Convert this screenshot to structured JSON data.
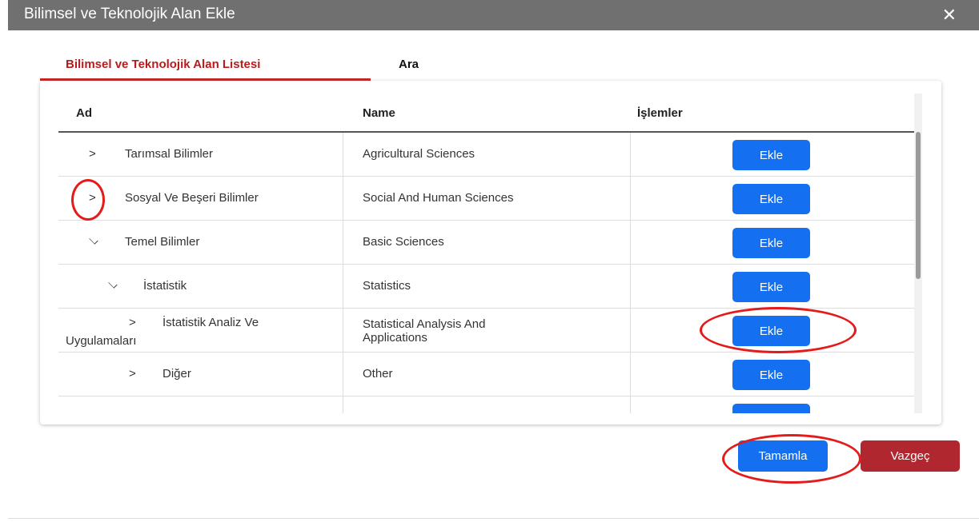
{
  "dialog": {
    "title": "Bilimsel ve Teknolojik Alan Ekle",
    "close_label": "✕"
  },
  "tabs": [
    {
      "label": "Bilimsel ve Teknolojik Alan Listesi",
      "active": true
    },
    {
      "label": "Ara",
      "active": false
    }
  ],
  "table": {
    "headers": {
      "ad": "Ad",
      "name": "Name",
      "islemler": "İşlemler"
    },
    "rows": [
      {
        "ad": "Tarımsal Bilimler",
        "name": "Agricultural Sciences",
        "expander": "collapsed",
        "action": "Ekle"
      },
      {
        "ad": "Sosyal Ve Beşeri Bilimler",
        "name": "Social And Human Sciences",
        "expander": "collapsed",
        "action": "Ekle"
      },
      {
        "ad": "Temel Bilimler",
        "name": "Basic Sciences",
        "expander": "expanded",
        "action": "Ekle"
      },
      {
        "ad": "İstatistik",
        "name": "Statistics",
        "expander": "expanded",
        "action": "Ekle"
      },
      {
        "ad_line1": "İstatistik Analiz Ve",
        "ad_line2": "Uygulamaları",
        "name_line1": "Statistical Analysis And",
        "name_line2": "Applications",
        "expander": "collapsed",
        "action": "Ekle"
      },
      {
        "ad": "Diğer",
        "name": "Other",
        "expander": "collapsed",
        "action": "Ekle"
      }
    ]
  },
  "icons": {
    "collapsed": ">",
    "expanded": "chevron-down"
  },
  "footer": {
    "complete_label": "Tamamla",
    "cancel_label": "Vazgeç"
  },
  "colors": {
    "titlebar": "#707070",
    "primary_button": "#1470f0",
    "cancel_button": "#b0272f",
    "active_tab": "#b71c1c",
    "annotation": "#e31b1b"
  }
}
